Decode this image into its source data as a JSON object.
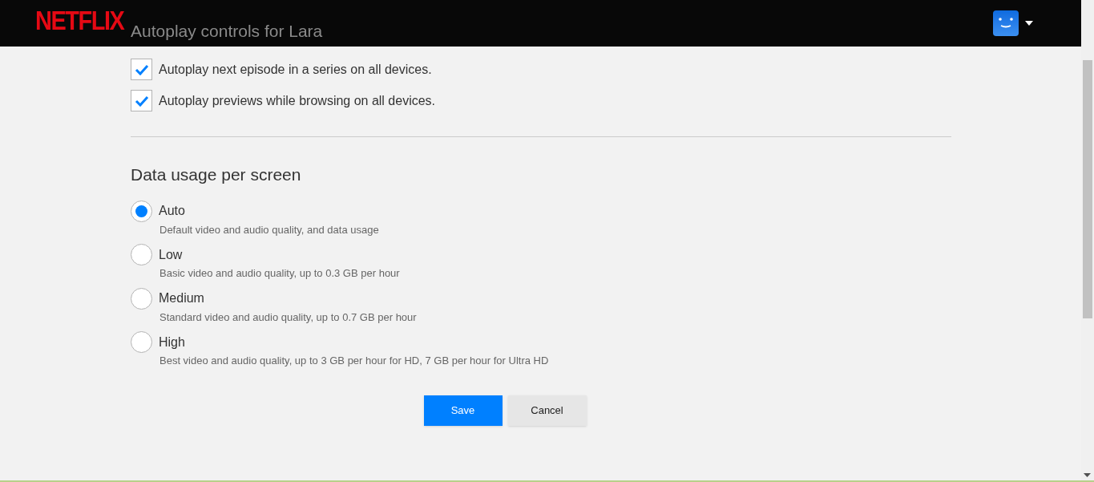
{
  "header": {
    "logo": "NETFLIX"
  },
  "autoplay": {
    "title": "Autoplay controls for Lara",
    "options": [
      {
        "label": "Autoplay next episode in a series on all devices.",
        "checked": true
      },
      {
        "label": "Autoplay previews while browsing on all devices.",
        "checked": true
      }
    ]
  },
  "data_usage": {
    "title": "Data usage per screen",
    "options": [
      {
        "label": "Auto",
        "description": "Default video and audio quality, and data usage",
        "selected": true
      },
      {
        "label": "Low",
        "description": "Basic video and audio quality, up to 0.3 GB per hour",
        "selected": false
      },
      {
        "label": "Medium",
        "description": "Standard video and audio quality, up to 0.7 GB per hour",
        "selected": false
      },
      {
        "label": "High",
        "description": "Best video and audio quality, up to 3 GB per hour for HD, 7 GB per hour for Ultra HD",
        "selected": false
      }
    ]
  },
  "buttons": {
    "save": "Save",
    "cancel": "Cancel"
  }
}
